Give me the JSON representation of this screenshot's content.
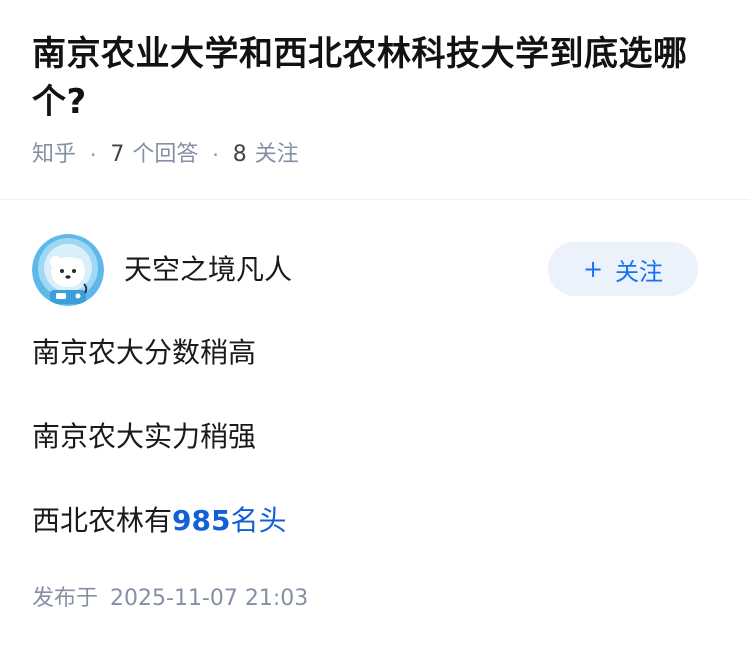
{
  "question": {
    "title": "南京农业大学和西北农林科技大学到底选哪个?",
    "site": "知乎",
    "answer_count": "7",
    "answer_label": "个回答",
    "follower_count": "8",
    "follower_label": "关注"
  },
  "answer": {
    "author": {
      "name": "天空之境凡人",
      "avatar_icon": "astronaut-avatar"
    },
    "follow_button": {
      "icon": "plus-icon",
      "symbol": "+",
      "label": "关注"
    },
    "paragraphs": [
      "南京农大分数稍高",
      "南京农大实力稍强"
    ],
    "last_paragraph": {
      "prefix": "西北农林有",
      "highlight_number": "985",
      "highlight_text": "名头"
    },
    "published_label": "发布于",
    "published_time": "2025-11-07 21:03"
  },
  "colors": {
    "accent": "#1772f6",
    "link": "#1160d8",
    "meta": "#8590a6",
    "follow_bg": "#ebf2fb"
  }
}
